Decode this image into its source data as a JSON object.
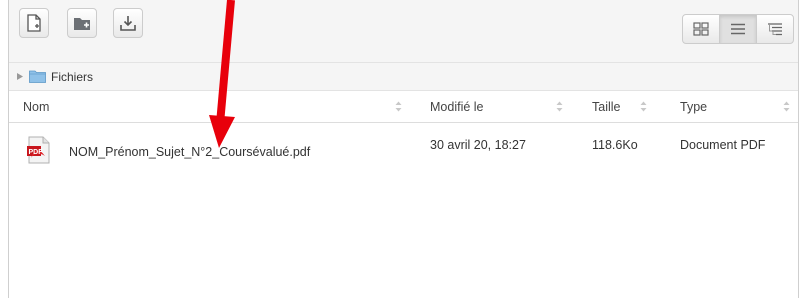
{
  "toolbar": {
    "buttons": [
      {
        "icon": "new-file-icon"
      },
      {
        "icon": "new-folder-icon"
      },
      {
        "icon": "download-icon"
      }
    ],
    "views": [
      {
        "icon": "grid-view-icon",
        "active": false
      },
      {
        "icon": "list-view-icon",
        "active": true
      },
      {
        "icon": "tree-view-icon",
        "active": false
      }
    ]
  },
  "path": {
    "folder": "Fichiers"
  },
  "columns": {
    "name": "Nom",
    "modified": "Modifié le",
    "size": "Taille",
    "type": "Type"
  },
  "files": [
    {
      "name": "NOM_Prénom_Sujet_N°2_Coursévalué.pdf",
      "modified": "30 avril 20, 18:27",
      "size": "118.6Ko",
      "type": "Document PDF",
      "icon": "pdf-file-icon"
    }
  ],
  "annotation": {
    "color": "#e8000b",
    "icon": "red-arrow-annotation"
  }
}
